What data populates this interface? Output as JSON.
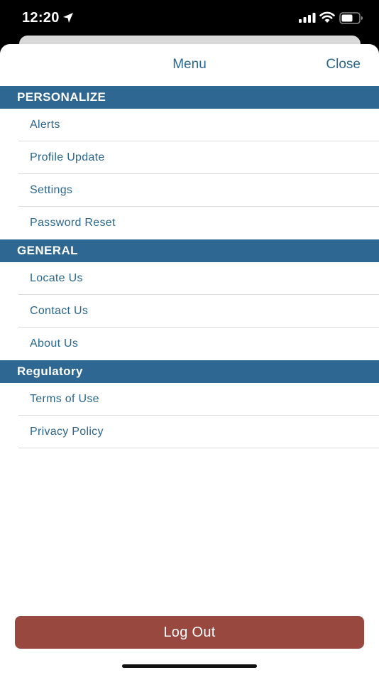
{
  "status_bar": {
    "time": "12:20",
    "icons": [
      "location-arrow-icon",
      "signal-icon",
      "wifi-icon",
      "battery-icon"
    ]
  },
  "header": {
    "title": "Menu",
    "close_label": "Close"
  },
  "sections": [
    {
      "title": "PERSONALIZE",
      "items": [
        "Alerts",
        "Profile Update",
        "Settings",
        "Password Reset"
      ]
    },
    {
      "title": "GENERAL",
      "items": [
        "Locate Us",
        "Contact Us",
        "About Us"
      ]
    },
    {
      "title": "Regulatory",
      "items": [
        "Terms of Use",
        "Privacy Policy"
      ]
    }
  ],
  "logout_label": "Log Out",
  "colors": {
    "section_header_bg": "#2e6791",
    "link_text": "#2a6790",
    "logout_bg": "#98483e"
  }
}
